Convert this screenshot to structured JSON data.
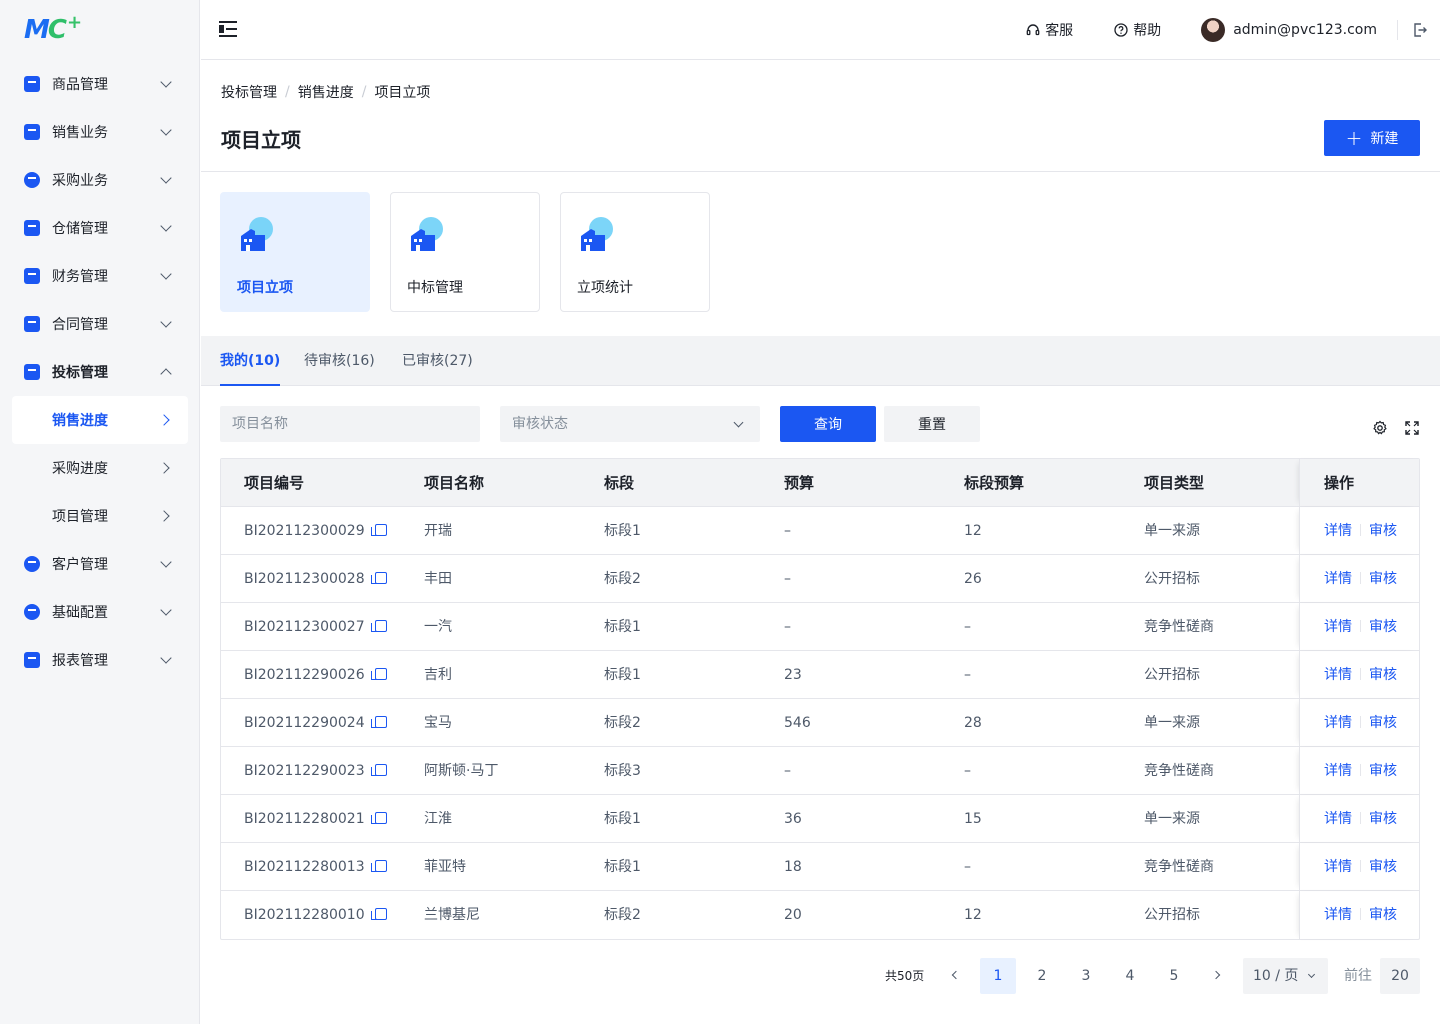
{
  "brand": {
    "logo_text_m": "M",
    "logo_text_c": "C",
    "logo_plus": "+"
  },
  "sidebar": {
    "items": [
      {
        "label": "商品管理"
      },
      {
        "label": "销售业务"
      },
      {
        "label": "采购业务"
      },
      {
        "label": "仓储管理"
      },
      {
        "label": "财务管理"
      },
      {
        "label": "合同管理"
      },
      {
        "label": "投标管理"
      },
      {
        "label": "销售进度"
      },
      {
        "label": "采购进度"
      },
      {
        "label": "项目管理"
      },
      {
        "label": "客户管理"
      },
      {
        "label": "基础配置"
      },
      {
        "label": "报表管理"
      }
    ]
  },
  "header": {
    "service": "客服",
    "help": "帮助",
    "user_email": "admin@pvc123.com"
  },
  "breadcrumb": [
    "投标管理",
    "销售进度",
    "项目立项"
  ],
  "page": {
    "title": "项目立项",
    "new_button": "新建",
    "new_plus": "+"
  },
  "cards": [
    {
      "label": "项目立项"
    },
    {
      "label": "中标管理"
    },
    {
      "label": "立项统计"
    }
  ],
  "tabs": [
    {
      "label": "我的(10)"
    },
    {
      "label": "待审核(16)"
    },
    {
      "label": "已审核(27)"
    }
  ],
  "filters": {
    "name_placeholder": "项目名称",
    "status_placeholder": "审核状态",
    "query": "查询",
    "reset": "重置"
  },
  "table": {
    "columns": [
      "项目编号",
      "项目名称",
      "标段",
      "预算",
      "标段预算",
      "项目类型",
      "操作"
    ],
    "rows": [
      {
        "code": "BI202112300029",
        "name": "开瑞",
        "section": "标段1",
        "budget": "–",
        "section_budget": "12",
        "type": "单一来源"
      },
      {
        "code": "BI202112300028",
        "name": "丰田",
        "section": "标段2",
        "budget": "–",
        "section_budget": "26",
        "type": "公开招标"
      },
      {
        "code": "BI202112300027",
        "name": "一汽",
        "section": "标段1",
        "budget": "–",
        "section_budget": "–",
        "type": "竞争性磋商"
      },
      {
        "code": "BI202112290026",
        "name": "吉利",
        "section": "标段1",
        "budget": "23",
        "section_budget": "–",
        "type": "公开招标"
      },
      {
        "code": "BI202112290024",
        "name": "宝马",
        "section": "标段2",
        "budget": "546",
        "section_budget": "28",
        "type": "单一来源"
      },
      {
        "code": "BI202112290023",
        "name": "阿斯顿·马丁",
        "section": "标段3",
        "budget": "–",
        "section_budget": "–",
        "type": "竞争性磋商"
      },
      {
        "code": "BI202112280021",
        "name": "江淮",
        "section": "标段1",
        "budget": "36",
        "section_budget": "15",
        "type": "单一来源"
      },
      {
        "code": "BI202112280013",
        "name": "菲亚特",
        "section": "标段1",
        "budget": "18",
        "section_budget": "–",
        "type": "竞争性磋商"
      },
      {
        "code": "BI202112280010",
        "name": "兰博基尼",
        "section": "标段2",
        "budget": "20",
        "section_budget": "12",
        "type": "公开招标"
      }
    ],
    "detail_label": "详情",
    "audit_label": "审核"
  },
  "pagination": {
    "total_text": "共50页",
    "pages": [
      "1",
      "2",
      "3",
      "4",
      "5"
    ],
    "page_size": "10 / 页",
    "goto_label": "前往",
    "goto_value": "20"
  },
  "colors": {
    "primary": "#1b57f2",
    "active_bg": "#e8f1ff",
    "sidebar_bg": "#f5f6f8"
  }
}
